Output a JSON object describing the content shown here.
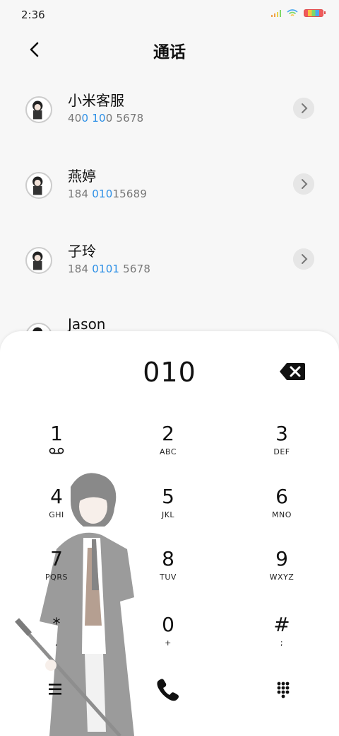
{
  "status_bar": {
    "time": "2:36"
  },
  "header": {
    "title": "通话"
  },
  "contacts": [
    {
      "name": "小米客服",
      "number_parts": [
        "40",
        "0 10",
        "0 5678"
      ]
    },
    {
      "name": "燕婷",
      "number_parts": [
        "184 ",
        "010",
        "15689"
      ]
    },
    {
      "name": "子玲",
      "number_parts": [
        "184 ",
        "0101",
        " 5678"
      ]
    },
    {
      "name": "Jason",
      "number_parts": [
        "",
        "",
        ""
      ]
    }
  ],
  "dialer": {
    "number": "010",
    "keys": [
      {
        "digit": "1",
        "letters": ""
      },
      {
        "digit": "2",
        "letters": "ABC"
      },
      {
        "digit": "3",
        "letters": "DEF"
      },
      {
        "digit": "4",
        "letters": "GHI"
      },
      {
        "digit": "5",
        "letters": "JKL"
      },
      {
        "digit": "6",
        "letters": "MNO"
      },
      {
        "digit": "7",
        "letters": "PQRS"
      },
      {
        "digit": "8",
        "letters": "TUV"
      },
      {
        "digit": "9",
        "letters": "WXYZ"
      },
      {
        "digit": "*",
        "letters": ","
      },
      {
        "digit": "0",
        "letters": "+"
      },
      {
        "digit": "#",
        "letters": ";"
      }
    ]
  },
  "icons": {
    "back": "chevron-left-icon",
    "voicemail": "voicemail-icon",
    "backspace": "backspace-icon",
    "menu": "menu-icon",
    "call": "phone-icon",
    "keypad": "keypad-icon"
  },
  "colors": {
    "highlight": "#2c8fe6",
    "background": "#f7f7f7"
  }
}
